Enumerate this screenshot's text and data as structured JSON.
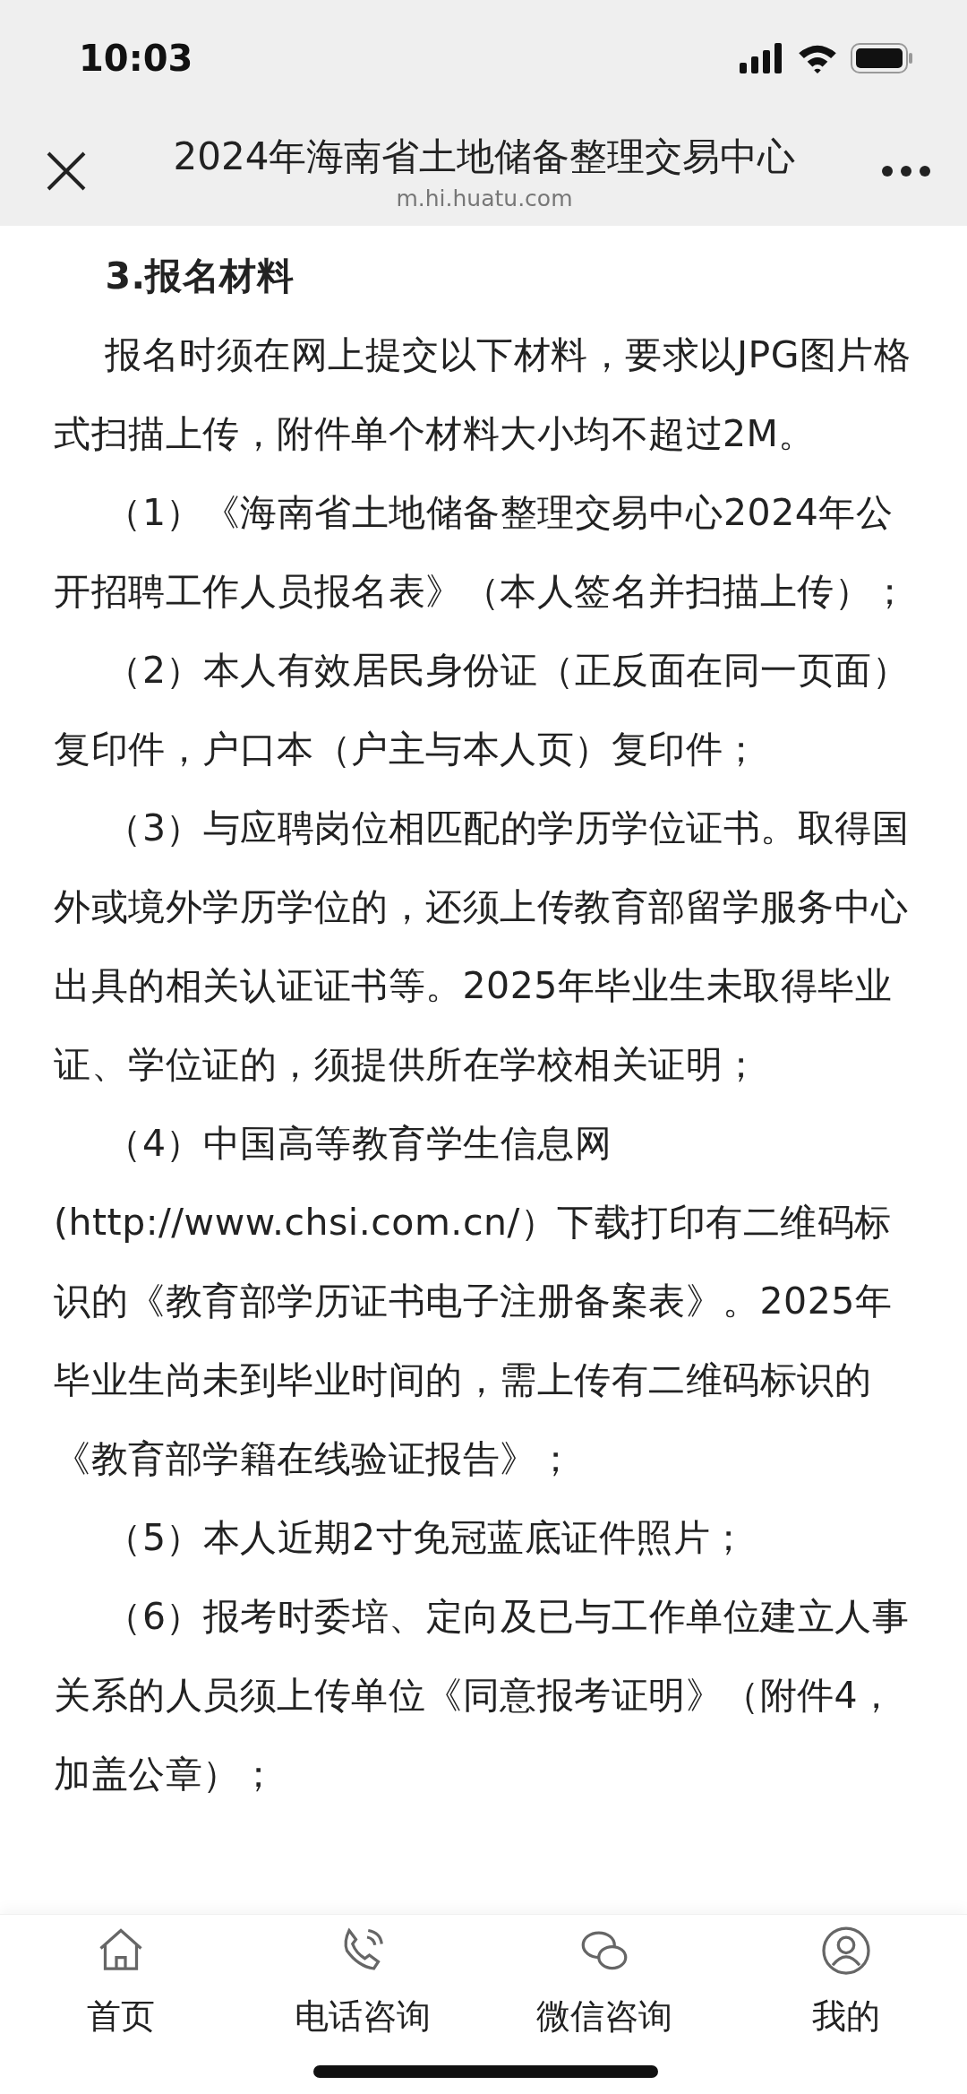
{
  "status_bar": {
    "time": "10:03"
  },
  "header": {
    "title": "2024年海南省土地储备整理交易中心",
    "domain": "m.hi.huatu.com"
  },
  "article": {
    "paragraphs": [
      {
        "kind": "heading",
        "text": "3.报名材料"
      },
      {
        "kind": "body",
        "text": "报名时须在网上提交以下材料，要求以JPG图片格式扫描上传，附件单个材料大小均不超过2M。"
      },
      {
        "kind": "body",
        "text": "（1）《海南省土地储备整理交易中心2024年公开招聘工作人员报名表》（本人签名并扫描上传）；"
      },
      {
        "kind": "body",
        "text": "（2）本人有效居民身份证（正反面在同一页面）复印件，户口本（户主与本人页）复印件；"
      },
      {
        "kind": "body",
        "text": "（3）与应聘岗位相匹配的学历学位证书。取得国外或境外学历学位的，还须上传教育部留学服务中心出具的相关认证证书等。2025年毕业生未取得毕业证、学位证的，须提供所在学校相关证明；"
      },
      {
        "kind": "body",
        "text": "（4）中国高等教育学生信息网(http://www.chsi.com.cn/）下载打印有二维码标识的《教育部学历证书电子注册备案表》。2025年毕业生尚未到毕业时间的，需上传有二维码标识的《教育部学籍在线验证报告》；"
      },
      {
        "kind": "body",
        "text": "（5）本人近期2寸免冠蓝底证件照片；"
      },
      {
        "kind": "body",
        "text": "（6）报考时委培、定向及已与工作单位建立人事关系的人员须上传单位《同意报考证明》（附件4，加盖公章）；"
      }
    ]
  },
  "bottom_nav": [
    {
      "kind": "home",
      "label": "首页"
    },
    {
      "kind": "phone",
      "label": "电话咨询"
    },
    {
      "kind": "chat",
      "label": "微信咨询"
    },
    {
      "kind": "user",
      "label": "我的"
    }
  ]
}
